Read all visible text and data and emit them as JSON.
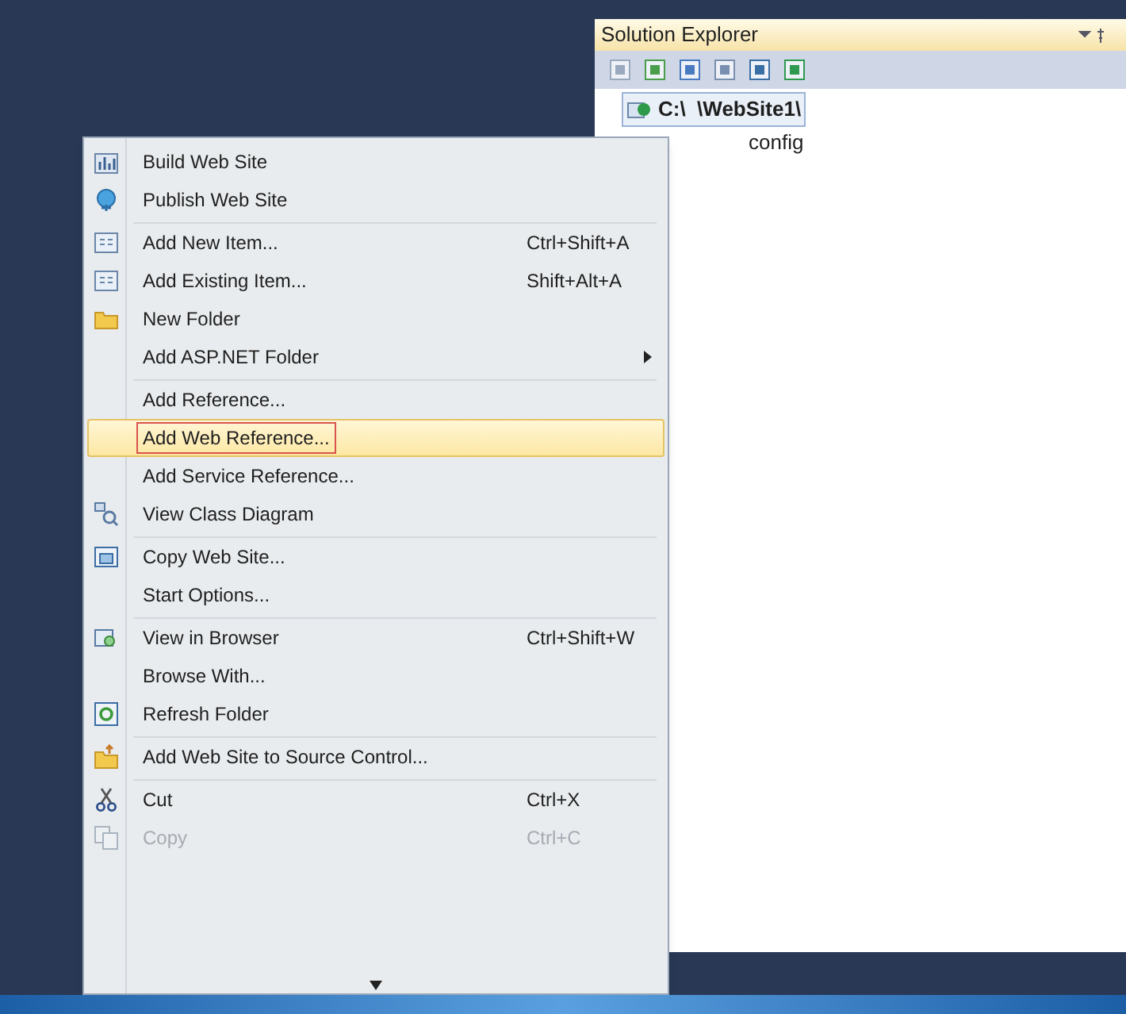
{
  "solution_explorer": {
    "title": "Solution Explorer",
    "root": "C:\\  \\WebSite1\\",
    "file": "config"
  },
  "context_menu": {
    "items": [
      {
        "label": "Build Web Site",
        "kind": "build",
        "separator_before": false,
        "selected": false,
        "disabled": false,
        "submenu": false
      },
      {
        "label": "Publish Web Site",
        "kind": "publish",
        "separator_before": false,
        "selected": false,
        "disabled": false,
        "submenu": false
      },
      {
        "label": "Add New Item...",
        "shortcut": "Ctrl+Shift+A",
        "kind": "form",
        "separator_before": true,
        "selected": false,
        "disabled": false,
        "submenu": false
      },
      {
        "label": "Add Existing Item...",
        "shortcut": "Shift+Alt+A",
        "kind": "form",
        "separator_before": false,
        "selected": false,
        "disabled": false,
        "submenu": false
      },
      {
        "label": "New Folder",
        "kind": "folder",
        "separator_before": false,
        "selected": false,
        "disabled": false,
        "submenu": false
      },
      {
        "label": "Add ASP.NET Folder",
        "kind": "plain",
        "separator_before": false,
        "selected": false,
        "disabled": false,
        "submenu": true
      },
      {
        "label": "Add Reference...",
        "kind": "plain",
        "separator_before": true,
        "selected": false,
        "disabled": false,
        "submenu": false
      },
      {
        "label": "Add Web Reference...",
        "kind": "plain",
        "separator_before": false,
        "selected": true,
        "disabled": false,
        "submenu": false
      },
      {
        "label": "Add Service Reference...",
        "kind": "plain",
        "separator_before": false,
        "selected": false,
        "disabled": false,
        "submenu": false
      },
      {
        "label": "View Class Diagram",
        "kind": "diagram",
        "separator_before": false,
        "selected": false,
        "disabled": false,
        "submenu": false
      },
      {
        "label": "Copy Web Site...",
        "kind": "copysite",
        "separator_before": true,
        "selected": false,
        "disabled": false,
        "submenu": false
      },
      {
        "label": "Start Options...",
        "kind": "plain",
        "separator_before": false,
        "selected": false,
        "disabled": false,
        "submenu": false
      },
      {
        "label": "View in Browser",
        "shortcut": "Ctrl+Shift+W",
        "kind": "browser",
        "separator_before": true,
        "selected": false,
        "disabled": false,
        "submenu": false
      },
      {
        "label": "Browse With...",
        "kind": "plain",
        "separator_before": false,
        "selected": false,
        "disabled": false,
        "submenu": false
      },
      {
        "label": "Refresh Folder",
        "kind": "refresh",
        "separator_before": false,
        "selected": false,
        "disabled": false,
        "submenu": false
      },
      {
        "label": "Add Web Site to Source Control...",
        "kind": "source",
        "separator_before": true,
        "selected": false,
        "disabled": false,
        "submenu": false
      },
      {
        "label": "Cut",
        "shortcut": "Ctrl+X",
        "kind": "cut",
        "separator_before": true,
        "selected": false,
        "disabled": false,
        "submenu": false
      },
      {
        "label": "Copy",
        "shortcut": "Ctrl+C",
        "kind": "copy",
        "separator_before": false,
        "selected": false,
        "disabled": true,
        "submenu": false
      }
    ]
  }
}
